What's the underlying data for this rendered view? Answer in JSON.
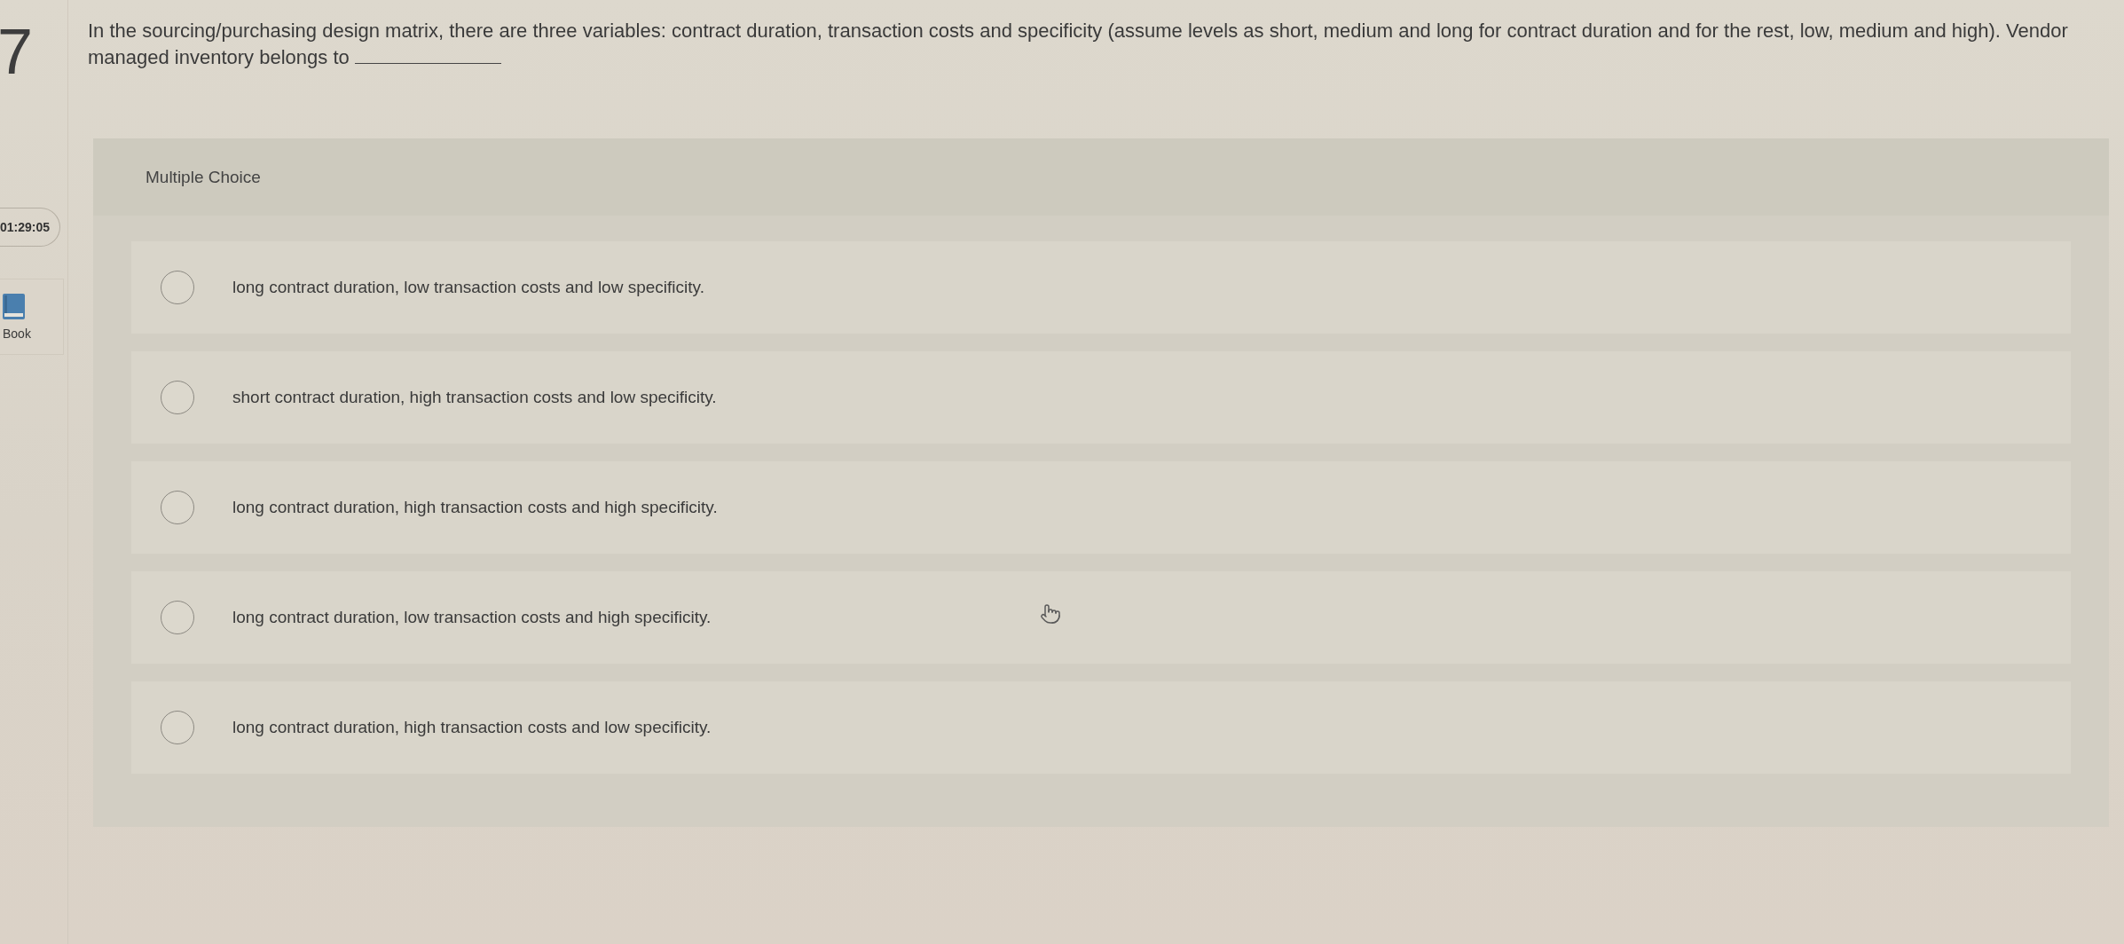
{
  "question": {
    "number": "7",
    "text": "In the sourcing/purchasing design matrix, there are three variables: contract duration, transaction costs and specificity (assume levels as short, medium and long for contract duration and for the rest, low, medium and high). Vendor managed inventory belongs to"
  },
  "sidebar": {
    "timer": "01:29:05",
    "ebook_label": "Book"
  },
  "answer_panel": {
    "header": "Multiple Choice",
    "options": [
      {
        "label": "long contract duration, low transaction costs and low specificity.",
        "selected": false
      },
      {
        "label": "short contract duration, high transaction costs and low specificity.",
        "selected": false
      },
      {
        "label": "long contract duration, high transaction costs and high specificity.",
        "selected": false
      },
      {
        "label": "long contract duration, low transaction costs and high specificity.",
        "selected": false
      },
      {
        "label": "long contract duration, high transaction costs and low specificity.",
        "selected": false
      }
    ]
  }
}
